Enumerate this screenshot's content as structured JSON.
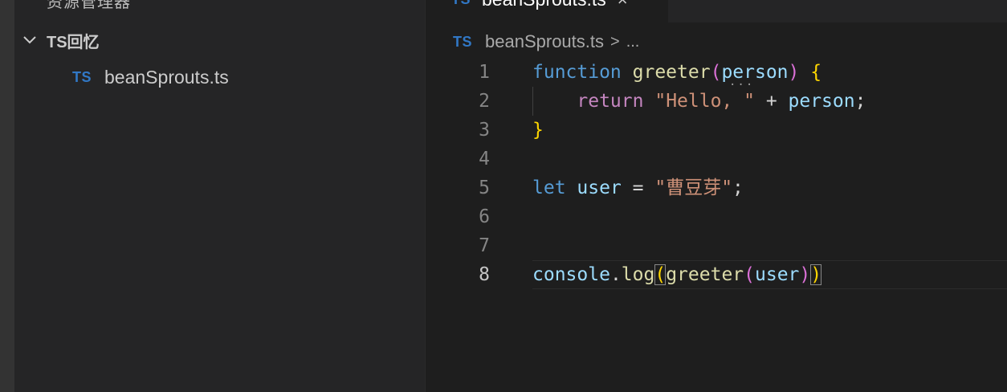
{
  "sidebar": {
    "title": "资源管理器",
    "folder": {
      "name": "TS回忆",
      "expanded": true
    },
    "files": [
      {
        "badge": "TS",
        "name": "beanSprouts.ts"
      }
    ]
  },
  "tab": {
    "badge": "TS",
    "label": "beanSprouts.ts",
    "close_glyph": "×"
  },
  "breadcrumb": {
    "badge": "TS",
    "file": "beanSprouts.ts",
    "separator": ">",
    "more": "..."
  },
  "code": {
    "line_numbers": [
      "1",
      "2",
      "3",
      "4",
      "5",
      "6",
      "7",
      "8"
    ],
    "current_line": 8,
    "lines": [
      [
        {
          "t": "function",
          "c": "k-blue"
        },
        {
          "t": " ",
          "c": "plain"
        },
        {
          "t": "greeter",
          "c": "fn"
        },
        {
          "t": "(",
          "c": "br2"
        },
        {
          "t": "person",
          "c": "var"
        },
        {
          "t": ")",
          "c": "br2"
        },
        {
          "t": " ",
          "c": "plain"
        },
        {
          "t": "{",
          "c": "br1"
        }
      ],
      [
        {
          "t": "    ",
          "c": "plain"
        },
        {
          "t": "return",
          "c": "k-purple"
        },
        {
          "t": " ",
          "c": "plain"
        },
        {
          "t": "\"Hello, \"",
          "c": "str"
        },
        {
          "t": " + ",
          "c": "plain"
        },
        {
          "t": "person",
          "c": "var"
        },
        {
          "t": ";",
          "c": "plain"
        }
      ],
      [
        {
          "t": "}",
          "c": "br1"
        }
      ],
      [],
      [
        {
          "t": "let",
          "c": "k-blue"
        },
        {
          "t": " ",
          "c": "plain"
        },
        {
          "t": "user",
          "c": "var"
        },
        {
          "t": " = ",
          "c": "plain"
        },
        {
          "t": "\"曹豆芽\"",
          "c": "str"
        },
        {
          "t": ";",
          "c": "plain"
        }
      ],
      [],
      [],
      [
        {
          "t": "console",
          "c": "var"
        },
        {
          "t": ".",
          "c": "plain"
        },
        {
          "t": "log",
          "c": "fn"
        },
        {
          "t": "(",
          "c": "br1 match"
        },
        {
          "t": "greeter",
          "c": "fn"
        },
        {
          "t": "(",
          "c": "br2"
        },
        {
          "t": "user",
          "c": "var"
        },
        {
          "t": ")",
          "c": "br2"
        },
        {
          "t": ")",
          "c": "br1 match"
        }
      ]
    ]
  },
  "colors": {
    "editor_bg": "#1e1e1e",
    "sidebar_bg": "#252526",
    "ts_badge": "#3178c6",
    "keyword_blue": "#569cd6",
    "keyword_purple": "#c586c0",
    "function": "#dcdcaa",
    "variable": "#9cdcfe",
    "string": "#ce9178",
    "bracket_gold": "#ffd700",
    "bracket_orchid": "#da70d6"
  }
}
